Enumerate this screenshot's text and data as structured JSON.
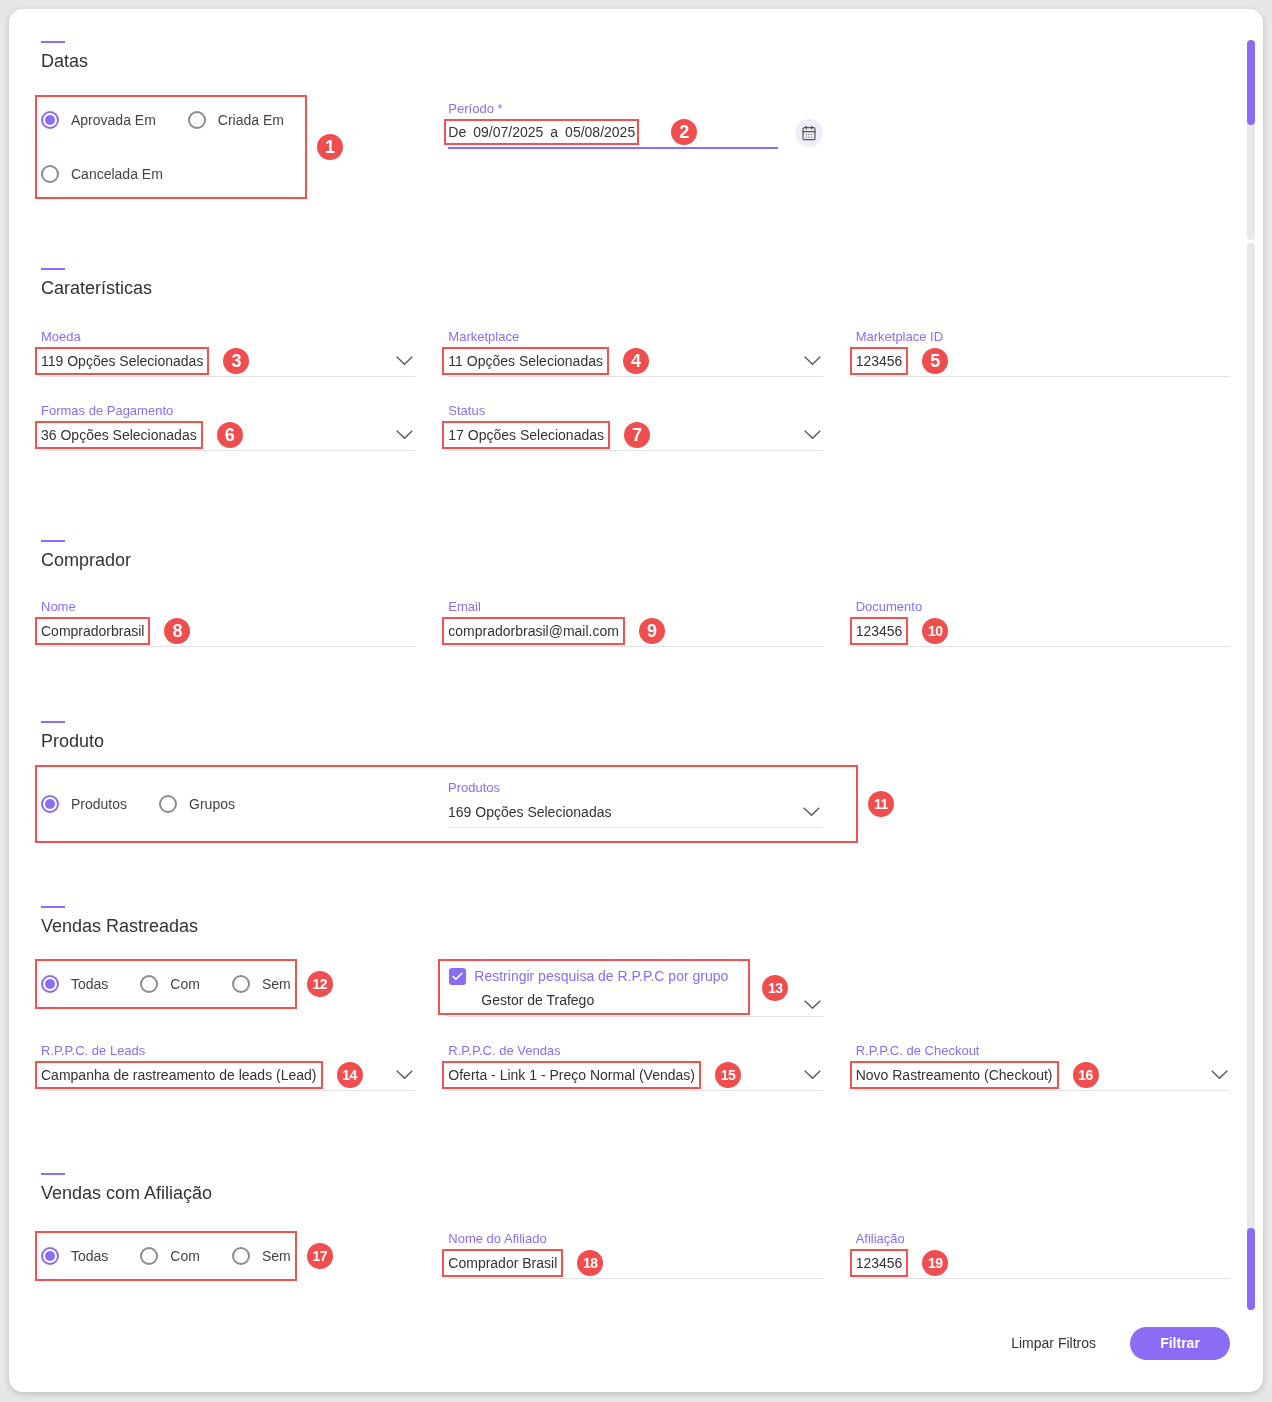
{
  "sections": [
    {
      "title": "Datas",
      "rows": [
        [
          {
            "kind": "radio_group",
            "callout": "1",
            "options": [
              {
                "label": "Aprovada Em",
                "selected": true
              },
              {
                "label": "Criada Em",
                "selected": false
              },
              {
                "label": "Cancelada Em",
                "selected": false
              }
            ]
          },
          {
            "kind": "date_range",
            "label": "Período *",
            "prefix": "De",
            "start": "09/07/2025",
            "separator": "a",
            "end": "05/08/2025",
            "focused": true,
            "callout": "2"
          }
        ]
      ]
    },
    {
      "title": "Caraterísticas",
      "rows": [
        [
          {
            "kind": "select",
            "label": "Moeda",
            "value": "119 Opções Selecionadas",
            "callout": "3"
          },
          {
            "kind": "select",
            "label": "Marketplace",
            "value": "11 Opções Selecionadas",
            "callout": "4"
          },
          {
            "kind": "text",
            "label": "Marketplace ID",
            "value": "123456",
            "callout": "5"
          }
        ],
        [
          {
            "kind": "select",
            "label": "Formas de Pagamento",
            "value": "36 Opções Selecionadas",
            "callout": "6"
          },
          {
            "kind": "select",
            "label": "Status",
            "value": "17 Opções Selecionadas",
            "callout": "7"
          }
        ]
      ]
    },
    {
      "title": "Comprador",
      "rows": [
        [
          {
            "kind": "text",
            "label": "Nome",
            "value": "Compradorbrasil",
            "callout": "8"
          },
          {
            "kind": "text",
            "label": "Email",
            "value": "compradorbrasil@mail.com",
            "callout": "9"
          },
          {
            "kind": "text",
            "label": "Documento",
            "value": "123456",
            "callout": "10"
          }
        ]
      ]
    },
    {
      "title": "Produto",
      "rows": [
        [
          {
            "kind": "product_filter",
            "callout": "11",
            "options": [
              {
                "label": "Produtos",
                "selected": true
              },
              {
                "label": "Grupos",
                "selected": false
              }
            ],
            "select": {
              "label": "Produtos",
              "value": "169 Opções Selecionadas"
            }
          }
        ]
      ]
    },
    {
      "title": "Vendas Rastreadas",
      "rows": [
        [
          {
            "kind": "radio_group",
            "callout": "12",
            "options": [
              {
                "label": "Todas",
                "selected": true
              },
              {
                "label": "Com",
                "selected": false
              },
              {
                "label": "Sem",
                "selected": false
              }
            ]
          },
          {
            "kind": "checkbox_select",
            "checkbox_label": "Restringir pesquisa de R.P.P.C por grupo",
            "checked": true,
            "value": "Gestor de Trafego",
            "callout": "13"
          }
        ],
        [
          {
            "kind": "select",
            "label": "R.P.P.C. de Leads",
            "value": "Campanha de rastreamento de leads (Lead)",
            "callout": "14"
          },
          {
            "kind": "select",
            "label": "R.P.P.C. de Vendas",
            "value": "Oferta - Link 1 - Preço Normal (Vendas)",
            "callout": "15"
          },
          {
            "kind": "select",
            "label": "R.P.P.C. de Checkout",
            "value": "Novo Rastreamento (Checkout)",
            "callout": "16"
          }
        ]
      ]
    },
    {
      "title": "Vendas com Afiliação",
      "rows": [
        [
          {
            "kind": "radio_group",
            "callout": "17",
            "options": [
              {
                "label": "Todas",
                "selected": true
              },
              {
                "label": "Com",
                "selected": false
              },
              {
                "label": "Sem",
                "selected": false
              }
            ]
          },
          {
            "kind": "text",
            "label": "Nome do Afiliado",
            "value": "Comprador Brasil",
            "callout": "18"
          },
          {
            "kind": "text",
            "label": "Afiliação",
            "value": "123456",
            "callout": "19"
          }
        ]
      ]
    }
  ],
  "actions": [
    {
      "kind": "text",
      "label": "Limpar Filtros"
    },
    {
      "kind": "primary",
      "label": "Filtrar"
    }
  ]
}
